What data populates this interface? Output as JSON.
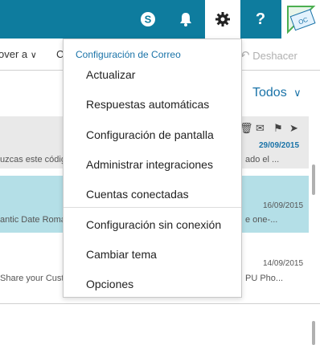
{
  "topbar": {
    "skype_icon": "skype-icon",
    "bell_icon": "bell-icon",
    "gear_icon": "gear-icon",
    "help_label": "?",
    "avatar_text": "OC"
  },
  "cmdbar": {
    "move_label": "over a",
    "c_label": "C",
    "undo_label": "Deshacer"
  },
  "filter": {
    "label": "Todos"
  },
  "messages": [
    {
      "snippet_left": "uzcas este código",
      "snippet_right": "ado el ...",
      "date": "29/09/2015"
    },
    {
      "snippet_left": "antic Date  Roma",
      "snippet_right": "e one-...",
      "date": "16/09/2015"
    },
    {
      "snippet_left": "Share your Cust",
      "snippet_right": "PU Pho...",
      "date": "14/09/2015"
    }
  ],
  "menu": {
    "header": "Configuración de Correo",
    "items": [
      "Actualizar",
      "Respuestas automáticas",
      "Configuración de pantalla",
      "Administrar integraciones",
      "Cuentas conectadas",
      "Configuración sin conexión",
      "Cambiar tema",
      "Opciones"
    ]
  },
  "colors": {
    "topbar": "#0e7c9e",
    "accent": "#1a73a8",
    "selected_row": "#b4dfe7"
  }
}
